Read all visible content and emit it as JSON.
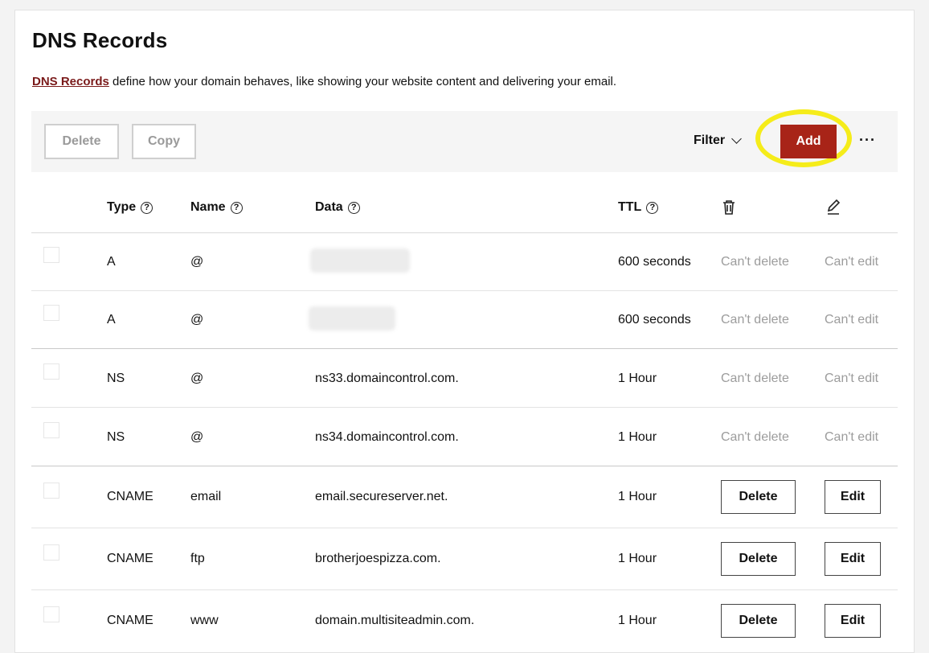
{
  "page": {
    "title": "DNS Records",
    "desc_link": "DNS Records",
    "desc_text": " define how your domain behaves, like showing your website content and delivering your email."
  },
  "toolbar": {
    "delete_label": "Delete",
    "copy_label": "Copy",
    "filter_label": "Filter",
    "add_label": "Add",
    "more_label": "···"
  },
  "table": {
    "headers": {
      "type": "Type",
      "name": "Name",
      "data": "Data",
      "ttl": "TTL"
    },
    "rows": [
      {
        "type": "A",
        "name": "@",
        "data": "",
        "ttl": "600 seconds",
        "delete": "Can't delete",
        "edit": "Can't edit"
      },
      {
        "type": "A",
        "name": "@",
        "data": "",
        "ttl": "600 seconds",
        "delete": "Can't delete",
        "edit": "Can't edit"
      },
      {
        "type": "NS",
        "name": "@",
        "data": "ns33.domaincontrol.com.",
        "ttl": "1 Hour",
        "delete": "Can't delete",
        "edit": "Can't edit"
      },
      {
        "type": "NS",
        "name": "@",
        "data": "ns34.domaincontrol.com.",
        "ttl": "1 Hour",
        "delete": "Can't delete",
        "edit": "Can't edit"
      },
      {
        "type": "CNAME",
        "name": "email",
        "data": "email.secureserver.net.",
        "ttl": "1 Hour",
        "delete": "Delete",
        "edit": "Edit"
      },
      {
        "type": "CNAME",
        "name": "ftp",
        "data": "brotherjoespizza.com.",
        "ttl": "1 Hour",
        "delete": "Delete",
        "edit": "Edit"
      },
      {
        "type": "CNAME",
        "name": "www",
        "data": "domain.multisiteadmin.com.",
        "ttl": "1 Hour",
        "delete": "Delete",
        "edit": "Edit"
      }
    ]
  },
  "icons": {
    "help": "?",
    "trash": "trash-icon",
    "pencil": "pencil-icon"
  },
  "colors": {
    "accent": "#a82418",
    "link": "#7a1a1a",
    "highlight": "#f5ec1a"
  }
}
